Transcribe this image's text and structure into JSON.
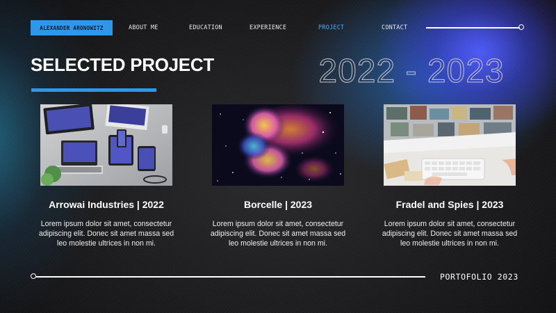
{
  "nav": {
    "brand": "ALEXANDER ARONOWITZ",
    "items": [
      {
        "label": "ABOUT ME"
      },
      {
        "label": "EDUCATION"
      },
      {
        "label": "EXPERIENCE"
      },
      {
        "label": "PROJECT",
        "active": true
      },
      {
        "label": "CONTACT"
      }
    ]
  },
  "header": {
    "title": "SELECTED PROJECT",
    "years": "2022 - 2023"
  },
  "projects": [
    {
      "title": "Arrowai Industries | 2022",
      "description": "Lorem ipsum dolor sit amet, consectetur adipiscing elit. Donec sit amet massa sed leo molestie ultrices in non mi.",
      "image": "devices-mockup-photo"
    },
    {
      "title": "Borcelle | 2023",
      "description": "Lorem ipsum dolor sit amet, consectetur adipiscing elit. Donec sit amet massa sed leo molestie ultrices in non mi.",
      "image": "colorful-nebula-photo"
    },
    {
      "title": "Fradel and Spies | 2023",
      "description": "Lorem ipsum dolor sit amet, consectetur adipiscing elit. Donec sit amet massa sed leo molestie ultrices in non mi.",
      "image": "desk-keyboard-photo"
    }
  ],
  "footer": {
    "label": "PORTOFOLIO 2023"
  },
  "colors": {
    "accent": "#2f97ea",
    "active_nav": "#4aa8f0",
    "background": "#18181a"
  }
}
